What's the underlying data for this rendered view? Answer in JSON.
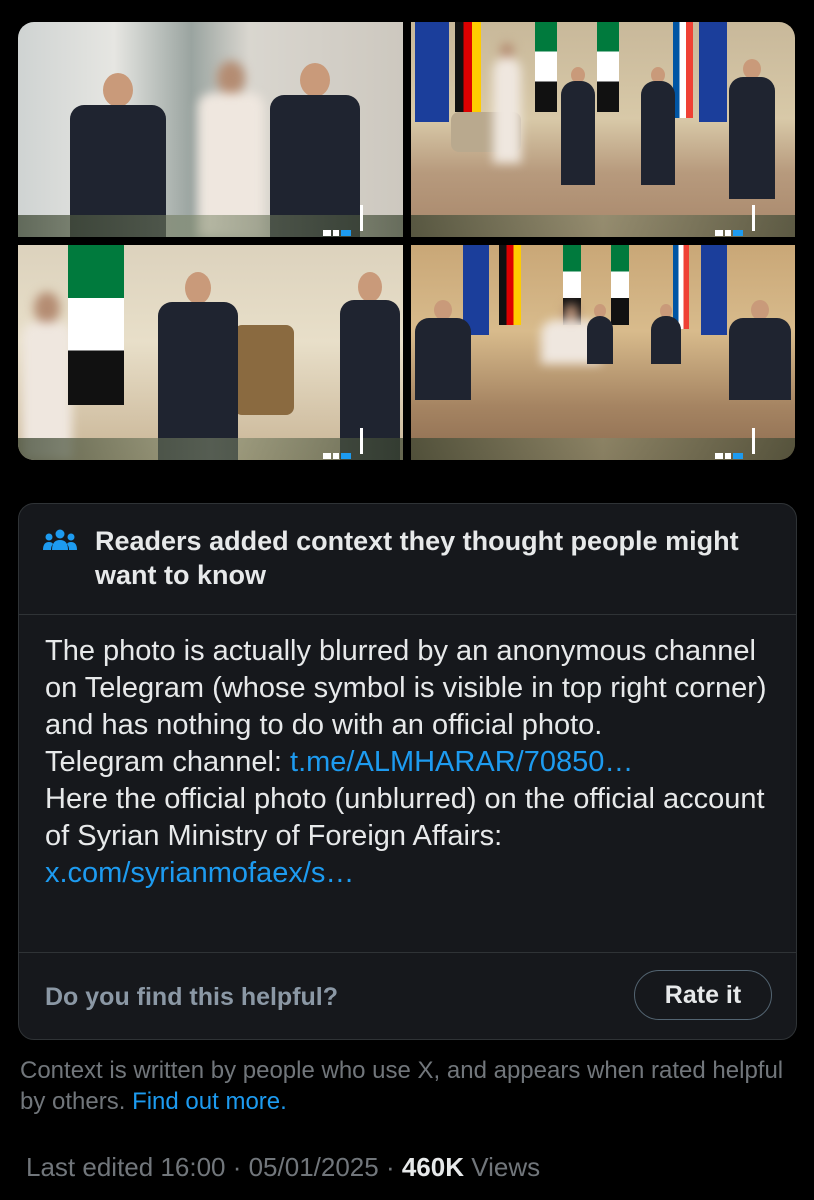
{
  "note": {
    "header_title": "Readers added context they thought people might want to know",
    "body_line1": "The photo is actually blurred by an anonymous channel on Telegram (whose symbol is visible in top right corner) and has nothing to do with an official photo.",
    "telegram_label": "Telegram channel: ",
    "telegram_link": "t.me/ALMHARAR/70850…",
    "official_text": "Here the official photo (unblurred) on the official account of Syrian Ministry of Foreign Affairs: ",
    "official_link": "x.com/syrianmofaex/s…",
    "helpful_question": "Do you find this helpful?",
    "rate_button": "Rate it"
  },
  "context_info": {
    "text": "Context is written by people who use X, and appears when rated helpful by others.",
    "link": "Find out more."
  },
  "meta": {
    "edited": "Last edited 16:00 · 05/01/2025",
    "separator": " · ",
    "views_count": "460K",
    "views_label": " Views"
  },
  "colors": {
    "background": "#000000",
    "card": "#16181c",
    "border": "#2f3336",
    "link": "#1d9bf0",
    "muted": "#71767b"
  },
  "icons": {
    "note_header": "people-group-icon",
    "watermark": "telegram-watermark-icon"
  }
}
